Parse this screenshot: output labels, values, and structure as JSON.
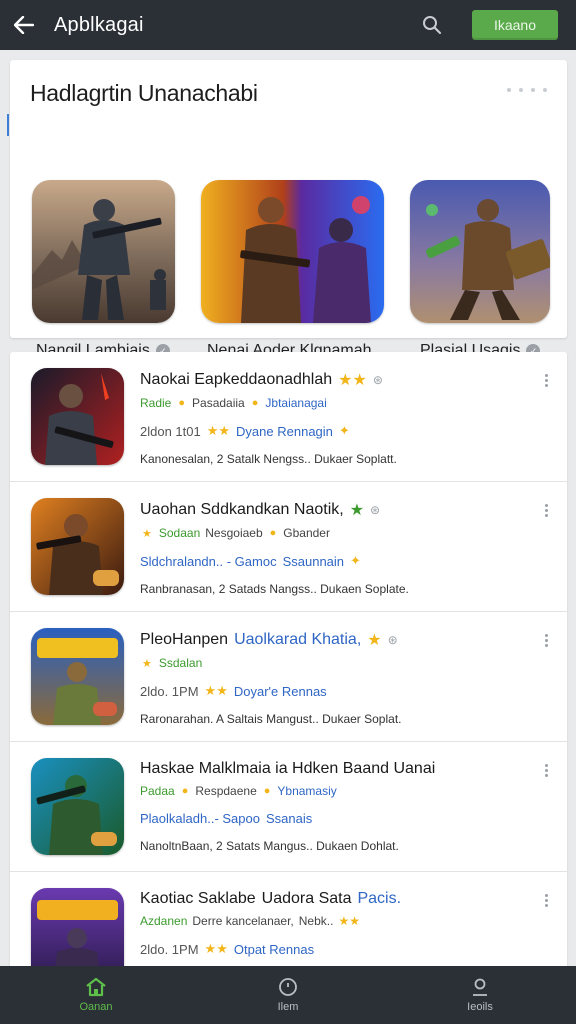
{
  "topbar": {
    "title": "Apblkagai",
    "primary_button": "Ikaano"
  },
  "featured": {
    "title": "Hadlagrtin Unanachabi",
    "items": [
      {
        "label": "Nangil Lambiais",
        "verified": true,
        "art": "soldier-ruins"
      },
      {
        "label": "Nenai Aoder Klgnamah",
        "verified": false,
        "art": "duel-neon"
      },
      {
        "label": "Plasial Usagis",
        "verified": true,
        "art": "blaster-hero"
      }
    ]
  },
  "list": [
    {
      "title": "Naokai Eapkeddaonadhlah",
      "title_badge": "★★",
      "dev_a": "Radie",
      "dev_b": "Pasadaiia",
      "dev_c": "Jbtaianagai",
      "stats": "2ldon 1t01",
      "stars": "★★",
      "stats_b": "Dyane Rennagin",
      "desc": "Kanonesalan, 2 Satalk Nengss.. Dukaer Soplatt."
    },
    {
      "title": "Uaohan Sddkandkan Naotik,",
      "title_badge": "★",
      "dev_a": "Sodaan",
      "dev_b": "Nesgoiaeb",
      "dev_c": "Gbander",
      "stats": "Sldchralandn.. - Gamoc",
      "stars": "",
      "stats_b": "Ssaunnain",
      "desc": "Ranbranasan, 2 Satads Nangss.. Dukaen Soplate."
    },
    {
      "title": "PleoHanpen",
      "title_blue": "Uaolkarad Khatia,",
      "title_badge": "★",
      "dev_a": "Ssdalan",
      "dev_b": "",
      "dev_c": "",
      "stats": "2ldo. 1PM",
      "stars": "★★",
      "stats_b": "Doyar'e Rennas",
      "desc": "Raronarahan. A Saltais Mangust.. Dukaer Soplat."
    },
    {
      "title": "Haskae Malklmaia ia Hdken Baand Uanai",
      "title_badge": "",
      "dev_a": "Padaa",
      "dev_b": "Respdaene",
      "dev_c": "Ybnamasiy",
      "stats": "Plaolkaladh..- Sapoo",
      "stars": "",
      "stats_b": "Ssanais",
      "desc": "NanoltnBaan, 2 Satats Mangus.. Dukaen Dohlat."
    },
    {
      "title": "Kaotiac Saklabe",
      "title_blue": "Uadora Sata",
      "title_tail": "Pacis.",
      "title_badge": "",
      "dev_a": "Azdanen",
      "dev_b": "Derre kancelanaer,",
      "dev_c": "Nebk..",
      "stats": "2ldo. 1PM",
      "stars": "★★",
      "stats_b": "Otpat Rennas",
      "desc": ""
    }
  ],
  "bottom_nav": [
    {
      "label": "Oanan",
      "icon": "home-icon",
      "active": true
    },
    {
      "label": "Ilem",
      "icon": "clock-icon",
      "active": false
    },
    {
      "label": "Ieoils",
      "icon": "user-icon",
      "active": false
    }
  ],
  "colors": {
    "bar": "#2b2f36",
    "accent_green": "#5aa94b",
    "link_blue": "#2f66c4"
  }
}
